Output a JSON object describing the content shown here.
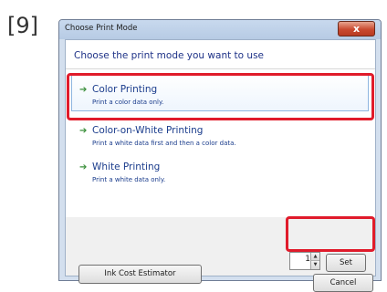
{
  "step_label": "[9]",
  "dialog": {
    "title": "Choose Print Mode",
    "close_label": "x",
    "heading": "Choose the print mode you want to use",
    "options": [
      {
        "title": "Color Printing",
        "description": "Print a color data only.",
        "selected": true
      },
      {
        "title": "Color-on-White Printing",
        "description": "Print a white data first and then a color data.",
        "selected": false
      },
      {
        "title": "White Printing",
        "description": "Print a white data only.",
        "selected": false
      }
    ],
    "arrow_icon": "green-arrow-icon",
    "ink_cost_button": "Ink Cost Estimator",
    "copies_value": "1",
    "set_button": "Set",
    "cancel_button": "Cancel"
  },
  "colors": {
    "highlight": "#e01b2b",
    "link_text": "#1a3c8c",
    "arrow": "#3a8f3a"
  }
}
